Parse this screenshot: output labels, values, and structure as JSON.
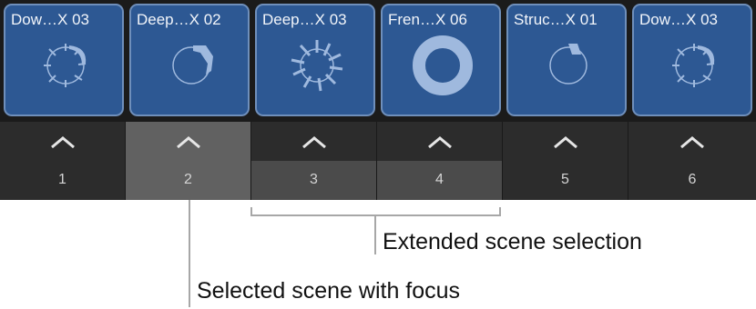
{
  "cells": [
    {
      "name": "Dow…X 03"
    },
    {
      "name": "Deep…X 02"
    },
    {
      "name": "Deep…X 03"
    },
    {
      "name": "Fren…X 06"
    },
    {
      "name": "Struc…X 01"
    },
    {
      "name": "Dow…X 03"
    }
  ],
  "scenes": [
    {
      "number": "1"
    },
    {
      "number": "2"
    },
    {
      "number": "3"
    },
    {
      "number": "4"
    },
    {
      "number": "5"
    },
    {
      "number": "6"
    }
  ],
  "callouts": {
    "extended": "Extended scene selection",
    "focus": "Selected scene with focus"
  },
  "colors": {
    "cell_fill": "#2d5893",
    "cell_border": "#6f8fbb",
    "waveform": "#9fb9de",
    "focused_scene": "#616161",
    "extended_scene": "#4b4b4b"
  }
}
